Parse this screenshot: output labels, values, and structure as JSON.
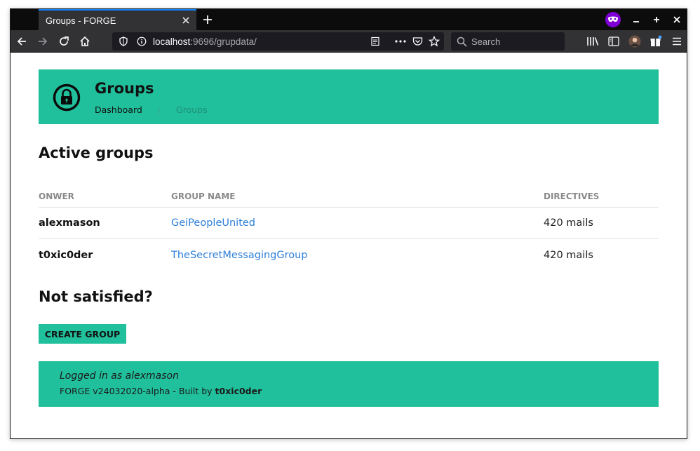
{
  "browser": {
    "tab_title": "Groups - FORGE",
    "url_host": "localhost",
    "url_path": ":9696/grupdata/",
    "search_placeholder": "Search",
    "colors": {
      "tabbar": "#0c0c0d",
      "toolbar": "#323234",
      "tab_accent": "#0a84ff",
      "private_badge": "#8000d7"
    }
  },
  "header": {
    "title": "Groups",
    "icon": "lock-icon",
    "breadcrumb": {
      "home": "Dashboard",
      "separator": "/",
      "current": "Groups"
    }
  },
  "active_groups": {
    "heading": "Active groups",
    "columns": [
      "ONWER",
      "GROUP NAME",
      "DIRECTIVES"
    ],
    "rows": [
      {
        "owner": "alexmason",
        "group": "GeiPeopleUnited",
        "directives": "420 mails"
      },
      {
        "owner": "t0xic0der",
        "group": "TheSecretMessagingGroup",
        "directives": "420 mails"
      }
    ]
  },
  "cta": {
    "heading": "Not satisfied?",
    "button": "CREATE GROUP"
  },
  "footer": {
    "logged_in": "Logged in as alexmason",
    "build_prefix": "FORGE v24032020-alpha - Built by ",
    "author": "t0xic0der"
  },
  "theme": {
    "accent": "#21c09c",
    "link": "#2f80d8"
  }
}
